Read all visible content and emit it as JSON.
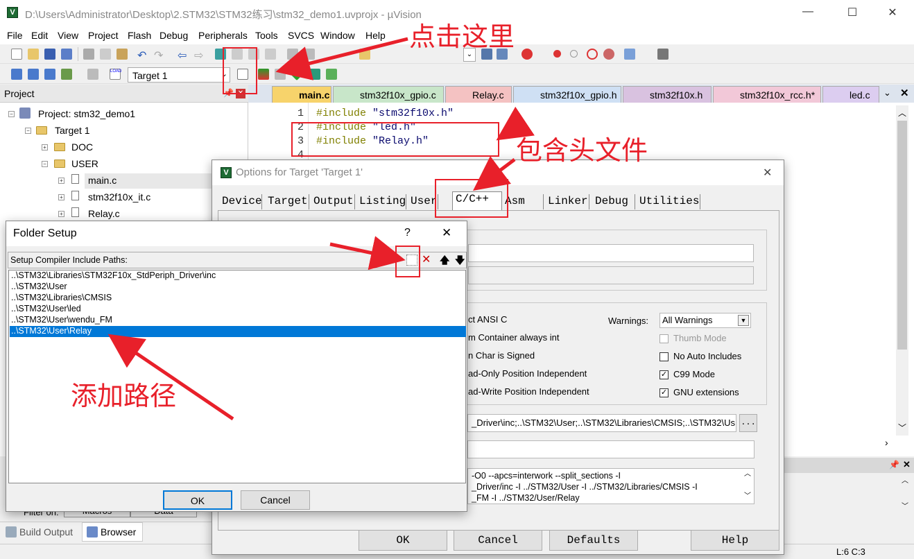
{
  "window": {
    "title": "D:\\Users\\Administrator\\Desktop\\2.STM32\\STM32练习\\stm32_demo1.uvprojx - µVision",
    "minimize": "—",
    "maximize": "☐",
    "close": "✕"
  },
  "menu": [
    "File",
    "Edit",
    "View",
    "Project",
    "Flash",
    "Debug",
    "Peripherals",
    "Tools",
    "SVCS",
    "Window",
    "Help"
  ],
  "toolbar": {
    "target": "Target 1"
  },
  "project_panel": {
    "title": "Project",
    "project": "Project: stm32_demo1",
    "target": "Target 1",
    "folders": [
      "DOC",
      "USER"
    ],
    "files": [
      "main.c",
      "stm32f10x_it.c",
      "Relay.c"
    ]
  },
  "editor_tabs": [
    "main.c",
    "stm32f10x_gpio.c",
    "Relay.c",
    "stm32f10x_gpio.h",
    "stm32f10x.h",
    "stm32f10x_rcc.h*",
    "led.c"
  ],
  "code": {
    "lines": [
      "1",
      "2",
      "3",
      "4"
    ],
    "l1a": "#include",
    "l1b": "\"stm32f10x.h\"",
    "l2a": "#include",
    "l2b": "\"led.h\"",
    "l3a": "#include",
    "l3b": "\"Relay.h\""
  },
  "options_dialog": {
    "title": "Options for Target 'Target 1'",
    "tabs": [
      "Device",
      "Target",
      "Output",
      "Listing",
      "User",
      "C/C++",
      "Asm",
      "Linker",
      "Debug",
      "Utilities"
    ],
    "warnings_label": "Warnings:",
    "warnings_value": "All Warnings",
    "left_labels": [
      "ct ANSI C",
      "m Container always int",
      "n Char is Signed",
      "ad-Only Position Independent",
      "ad-Write Position Independent"
    ],
    "right_checks": [
      {
        "label": "Thumb Mode",
        "checked": false,
        "disabled": true
      },
      {
        "label": "No Auto Includes",
        "checked": false,
        "disabled": false
      },
      {
        "label": "C99 Mode",
        "checked": true,
        "disabled": false
      },
      {
        "label": "GNU extensions",
        "checked": true,
        "disabled": false
      }
    ],
    "include_paths": "_Driver\\inc;..\\STM32\\User;..\\STM32\\Libraries\\CMSIS;..\\STM32\\Us",
    "browse": "...",
    "compiler_control": [
      "-O0 --apcs=interwork --split_sections -I",
      "_Driver/inc -I ../STM32/User -I ../STM32/Libraries/CMSIS -I",
      "_FM -I ../STM32/User/Relay"
    ],
    "buttons": {
      "ok": "OK",
      "cancel": "Cancel",
      "defaults": "Defaults",
      "help": "Help"
    }
  },
  "folder_setup": {
    "title": "Folder Setup",
    "help": "?",
    "close": "✕",
    "label": "Setup Compiler Include Paths:",
    "paths": [
      "..\\STM32\\Libraries\\STM32F10x_StdPeriph_Driver\\inc",
      "..\\STM32\\User",
      "..\\STM32\\Libraries\\CMSIS",
      "..\\STM32\\User\\led",
      "..\\STM32\\User\\wendu_FM",
      "..\\STM32\\User\\Relay"
    ],
    "ok": "OK",
    "cancel": "Cancel",
    "delete": "✕",
    "up": "🡅",
    "down": "🡇"
  },
  "bottom_tabs": {
    "build": "Build Output",
    "browser": "Browser",
    "filter": "Filter on:",
    "macros": "Macros",
    "data": "Data"
  },
  "status": {
    "pos": "L:6 C:3"
  },
  "annotations": {
    "click_here": "点击这里",
    "include_header": "包含头文件",
    "add_path": "添加路径"
  },
  "colors": {
    "annotation": "#e8202a",
    "selection": "#0078d7"
  }
}
